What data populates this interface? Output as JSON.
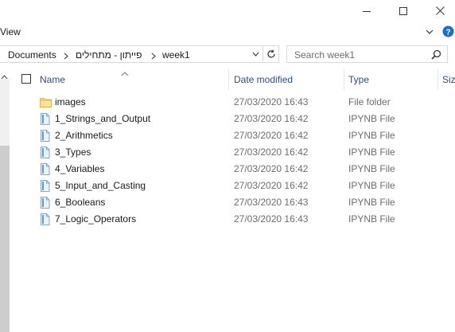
{
  "titlebar": {
    "minimize_icon": "minimize-icon",
    "maximize_icon": "maximize-icon",
    "close_icon": "close-icon"
  },
  "ribbon": {
    "view_tab": "View",
    "chevron_icon": "chevron-down-icon",
    "help_icon": "help-icon"
  },
  "address": {
    "crumbs": [
      "Documents",
      "פייתון - מתחילים",
      "week1"
    ],
    "search_placeholder": "Search week1"
  },
  "columns": {
    "name": "Name",
    "date": "Date modified",
    "type": "Type",
    "size": "Siz"
  },
  "files": [
    {
      "name": "images",
      "date": "27/03/2020 16:43",
      "type": "File folder",
      "icon": "folder-icon"
    },
    {
      "name": "1_Strings_and_Output",
      "date": "27/03/2020 16:42",
      "type": "IPYNB File",
      "icon": "file-icon"
    },
    {
      "name": "2_Arithmetics",
      "date": "27/03/2020 16:42",
      "type": "IPYNB File",
      "icon": "file-icon"
    },
    {
      "name": "3_Types",
      "date": "27/03/2020 16:42",
      "type": "IPYNB File",
      "icon": "file-icon"
    },
    {
      "name": "4_Variables",
      "date": "27/03/2020 16:42",
      "type": "IPYNB File",
      "icon": "file-icon"
    },
    {
      "name": "5_Input_and_Casting",
      "date": "27/03/2020 16:42",
      "type": "IPYNB File",
      "icon": "file-icon"
    },
    {
      "name": "6_Booleans",
      "date": "27/03/2020 16:43",
      "type": "IPYNB File",
      "icon": "file-icon"
    },
    {
      "name": "7_Logic_Operators",
      "date": "27/03/2020 16:43",
      "type": "IPYNB File",
      "icon": "file-icon"
    }
  ],
  "colors": {
    "accent": "#0078d7",
    "header_text": "#2f4f7f",
    "folder": "#f8d775",
    "file_icon": "#5b9bd5"
  }
}
